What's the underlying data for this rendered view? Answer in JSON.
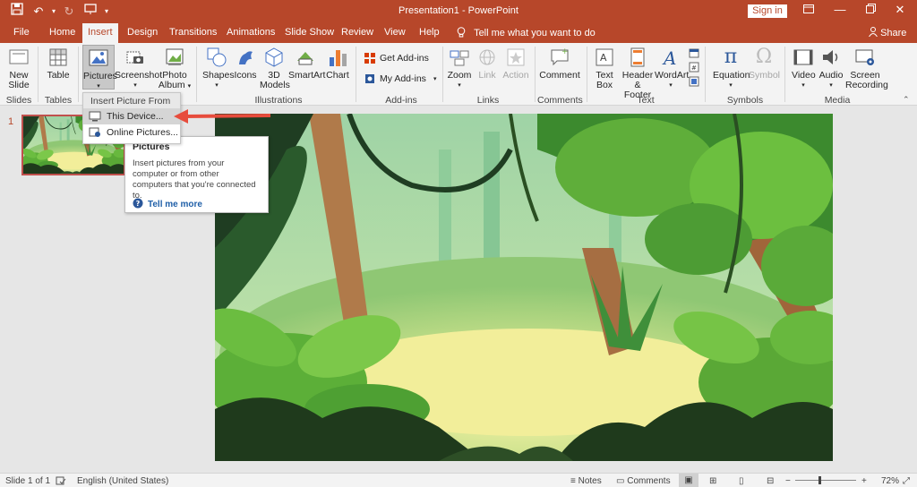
{
  "titlebar": {
    "title": "Presentation1  -  PowerPoint",
    "signin": "Sign in",
    "qat_icons": [
      "save-icon",
      "undo-icon",
      "redo-icon",
      "start-from-beginning-icon",
      "customize-qat-icon"
    ],
    "window_controls": [
      "ribbon-display-icon",
      "minimize-icon",
      "restore-icon",
      "close-icon"
    ]
  },
  "tabs": {
    "items": [
      "File",
      "Home",
      "Insert",
      "Design",
      "Transitions",
      "Animations",
      "Slide Show",
      "Review",
      "View",
      "Help"
    ],
    "active": "Insert",
    "tellme": "Tell me what you want to do",
    "share": "Share"
  },
  "ribbon": {
    "new_slide": "New\nSlide",
    "table": "Table",
    "pictures": "Pictures",
    "screenshot": "Screenshot",
    "photo_album": "Photo\nAlbum",
    "shapes": "Shapes",
    "icons": "Icons",
    "models": "3D\nModels",
    "smartart": "SmartArt",
    "chart": "Chart",
    "get_addins": "Get Add-ins",
    "my_addins": "My Add-ins",
    "zoom": "Zoom",
    "link": "Link",
    "action": "Action",
    "comment": "Comment",
    "textbox": "Text\nBox",
    "header_footer": "Header\n& Footer",
    "wordart": "WordArt",
    "equation": "Equation",
    "symbol": "Symbol",
    "video": "Video",
    "audio": "Audio",
    "screen_recording": "Screen\nRecording",
    "groups": {
      "slides": "Slides",
      "tables": "Tables",
      "illustrations": "Illustrations",
      "addins": "Add-ins",
      "links": "Links",
      "comments": "Comments",
      "text": "Text",
      "symbols": "Symbols",
      "media": "Media"
    }
  },
  "dropdown": {
    "header": "Insert Picture From",
    "items": [
      "This Device...",
      "Online Pictures..."
    ]
  },
  "tooltip": {
    "title": "Pictures",
    "body": "Insert pictures from your computer or from other computers that you're connected to.",
    "link": "Tell me more"
  },
  "thumbnails": {
    "number": "1"
  },
  "statusbar": {
    "slide": "Slide 1 of 1",
    "language": "English (United States)",
    "notes": "Notes",
    "comments": "Comments",
    "zoom": "72%"
  },
  "colors": {
    "accent": "#b7472a",
    "ribbon_bg": "#f3f3f3",
    "arrow": "#e74c3c"
  }
}
